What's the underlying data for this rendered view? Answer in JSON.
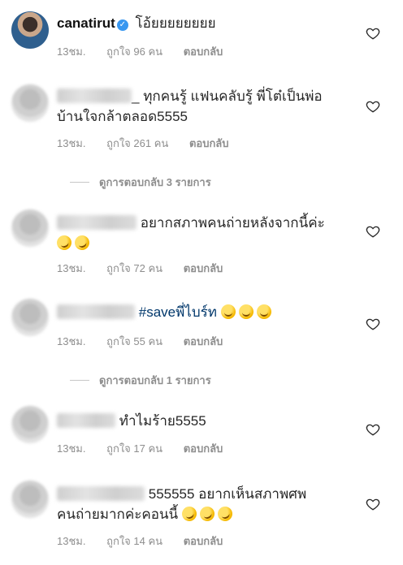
{
  "comments": [
    {
      "username": "canatirut",
      "text": "โอ้ยยยยยยยย",
      "time": "13ชม.",
      "likes": "ถูกใจ 96 คน",
      "reply": "ตอบกลับ"
    },
    {
      "username_suffix": "_",
      "text_line1": "ทุกคนรู้ แฟนคลับรู้ พี่โต๋เป็นพ่อ",
      "text_line2": "บ้านใจกล้าตลอด5555",
      "time": "13ชม.",
      "likes": "ถูกใจ 261 คน",
      "reply": "ตอบกลับ"
    },
    {
      "text": "อยากสภาพคนถ่ายหลังจากนี้ค่ะ",
      "emoji": "rolling-on-floor-laughing",
      "time": "13ชม.",
      "likes": "ถูกใจ 72 คน",
      "reply": "ตอบกลับ"
    },
    {
      "text": "#saveพี่ไบร์ท",
      "emoji": "face-with-tears-of-joy",
      "time": "13ชม.",
      "likes": "ถูกใจ 55 คน",
      "reply": "ตอบกลับ"
    },
    {
      "text": "ทำไมร้าย5555",
      "time": "13ชม.",
      "likes": "ถูกใจ 17 คน",
      "reply": "ตอบกลับ"
    },
    {
      "text_line1": "555555 อยากเห็นสภาพศพ",
      "text_line2": "คนถ่ายมากค่ะคอนนี้",
      "emoji": "rolling-on-floor-laughing",
      "time": "13ชม.",
      "likes": "ถูกใจ 14 คน",
      "reply": "ตอบกลับ"
    }
  ],
  "view_replies": [
    "ดูการตอบกลับ 3 รายการ",
    "ดูการตอบกลับ 1 รายการ"
  ],
  "colors": {
    "meta": "#8e8e8e",
    "hashtag": "#00376b",
    "verified": "#3897f0"
  }
}
